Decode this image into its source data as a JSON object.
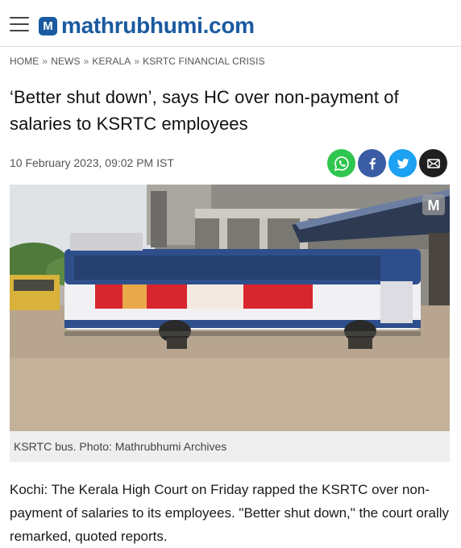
{
  "header": {
    "logo_badge": "M",
    "logo_text": "mathrubhumi.com"
  },
  "breadcrumb": [
    "HOME",
    "NEWS",
    "KERALA",
    "KSRTC FINANCIAL CRISIS"
  ],
  "breadcrumb_separator": "»",
  "article": {
    "headline": "‘Better shut down’, says HC over non-payment of salaries to KSRTC employees",
    "dateline": "10 February 2023, 09:02 PM IST",
    "image_watermark": "M",
    "image_caption": "KSRTC bus. Photo: Mathrubhumi Archives",
    "body": "Kochi: The Kerala High Court on Friday rapped the KSRTC over non-payment of salaries to its employees. \"Better shut down,\" the court orally remarked, quoted reports."
  },
  "share_buttons": [
    {
      "name": "whatsapp",
      "icon": "whatsapp-icon",
      "color": "#2fc64f"
    },
    {
      "name": "facebook",
      "icon": "facebook-icon",
      "color": "#3a5ca5"
    },
    {
      "name": "twitter",
      "icon": "twitter-icon",
      "color": "#1da1f2"
    },
    {
      "name": "email",
      "icon": "email-icon",
      "color": "#1f1f1f"
    }
  ],
  "colors": {
    "brand": "#1a5aa0",
    "bus_blue": "#2f4f8c",
    "ad_red": "#d8262e"
  }
}
